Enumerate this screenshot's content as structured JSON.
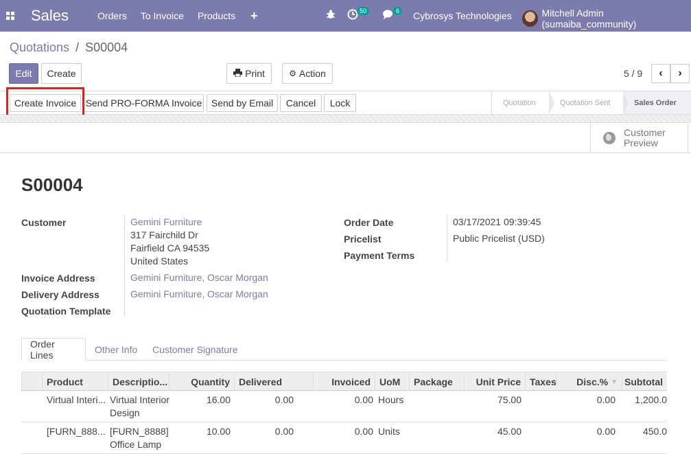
{
  "topbar": {
    "app_name": "Sales",
    "menu": [
      "Orders",
      "To Invoice",
      "Products"
    ],
    "plus": "+",
    "activity_count": "50",
    "messages_count": "6",
    "company": "Cybrosys Technologies",
    "user": "Mitchell Admin (sumaiba_community)"
  },
  "breadcrumb": {
    "parent": "Quotations",
    "separator": "/",
    "current": "S00004"
  },
  "control": {
    "edit": "Edit",
    "create": "Create",
    "print": "Print",
    "action": "Action",
    "pager": "5 / 9"
  },
  "status_buttons": [
    "Create Invoice",
    "Send PRO-FORMA Invoice",
    "Send by Email",
    "Cancel",
    "Lock"
  ],
  "stages": [
    "Quotation",
    "Quotation Sent",
    "Sales Order"
  ],
  "active_stage": "Sales Order",
  "preview": {
    "line1": "Customer",
    "line2": "Preview"
  },
  "form": {
    "title": "S00004",
    "customer_label": "Customer",
    "customer_name": "Gemini Furniture",
    "address1": "317 Fairchild Dr",
    "address2": "Fairfield CA 94535",
    "address3": "United States",
    "invoice_address_label": "Invoice Address",
    "invoice_address": "Gemini Furniture, Oscar Morgan",
    "delivery_address_label": "Delivery Address",
    "delivery_address": "Gemini Furniture, Oscar Morgan",
    "template_label": "Quotation Template",
    "order_date_label": "Order Date",
    "order_date": "03/17/2021 09:39:45",
    "pricelist_label": "Pricelist",
    "pricelist": "Public Pricelist (USD)",
    "payment_terms_label": "Payment Terms"
  },
  "tabs": [
    "Order Lines",
    "Other Info",
    "Customer Signature"
  ],
  "table": {
    "headers": [
      "Product",
      "Descriptio...",
      "Quantity",
      "Delivered",
      "Invoiced",
      "UoM",
      "Package",
      "Unit Price",
      "Taxes",
      "Disc.%",
      "Subtotal"
    ],
    "rows": [
      {
        "product": "Virtual Interi...",
        "desc1": "Virtual Interior",
        "desc2": "Design",
        "quantity": "16.00",
        "delivered": "0.00",
        "invoiced": "0.00",
        "uom": "Hours",
        "unit_price": "75.00",
        "disc": "0.00",
        "subtotal": "1,200.0"
      },
      {
        "product": "[FURN_888...",
        "desc1": "[FURN_8888]",
        "desc2": "Office Lamp",
        "quantity": "10.00",
        "delivered": "0.00",
        "invoiced": "0.00",
        "uom": "Units",
        "unit_price": "45.00",
        "disc": "0.00",
        "subtotal": "450.0"
      }
    ]
  },
  "colors": {
    "brand": "#7c7bad",
    "highlight": "#e0201b",
    "badge": "#00a09d"
  }
}
